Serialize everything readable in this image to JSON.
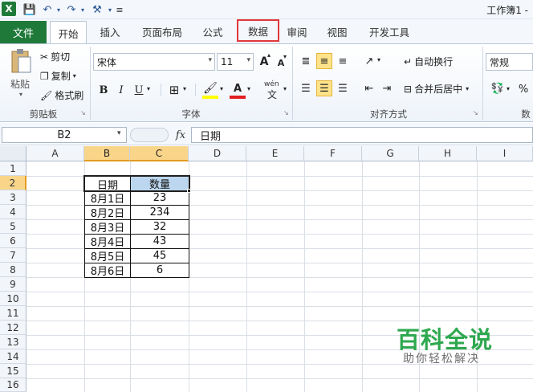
{
  "title_bar": {
    "title": "工作簿1 -"
  },
  "tabs": [
    {
      "label": "文件"
    },
    {
      "label": "开始"
    },
    {
      "label": "插入"
    },
    {
      "label": "页面布局"
    },
    {
      "label": "公式"
    },
    {
      "label": "数据"
    },
    {
      "label": "审阅"
    },
    {
      "label": "视图"
    },
    {
      "label": "开发工具"
    }
  ],
  "ribbon": {
    "clipboard": {
      "paste": "粘贴",
      "cut": "剪切",
      "copy": "复制",
      "format_painter": "格式刷",
      "group_label": "剪贴板"
    },
    "font": {
      "font_name": "宋体",
      "font_size": "11",
      "group_label": "字体",
      "grow": "A",
      "shrink": "A",
      "bold": "B",
      "italic": "I",
      "underline": "U",
      "phonetic": "wén"
    },
    "alignment": {
      "wrap_text": "自动换行",
      "merge_center": "合并后居中",
      "group_label": "对齐方式"
    },
    "number": {
      "format": "常规",
      "group_label": "数",
      "percent": "%"
    }
  },
  "formula_bar": {
    "name_box": "B2",
    "fx": "fx",
    "content": "日期"
  },
  "columns": [
    "A",
    "B",
    "C",
    "D",
    "E",
    "F",
    "G",
    "H",
    "I"
  ],
  "rows": [
    "1",
    "2",
    "3",
    "4",
    "5",
    "6",
    "7",
    "8",
    "9",
    "10",
    "11",
    "12",
    "13",
    "14",
    "15",
    "16"
  ],
  "table": {
    "headers": [
      "日期",
      "数量"
    ],
    "rows": [
      [
        "8月1日",
        "23"
      ],
      [
        "8月2日",
        "234"
      ],
      [
        "8月3日",
        "32"
      ],
      [
        "8月4日",
        "43"
      ],
      [
        "8月5日",
        "45"
      ],
      [
        "8月6日",
        "6"
      ]
    ]
  },
  "watermark": {
    "title": "百科全说",
    "subtitle": "助你轻松解决"
  },
  "colors": {
    "file_tab": "#1f7a3a",
    "highlight_box": "#e0383c",
    "selected_header": "#f9d58a",
    "watermark": "#2ea84f"
  }
}
